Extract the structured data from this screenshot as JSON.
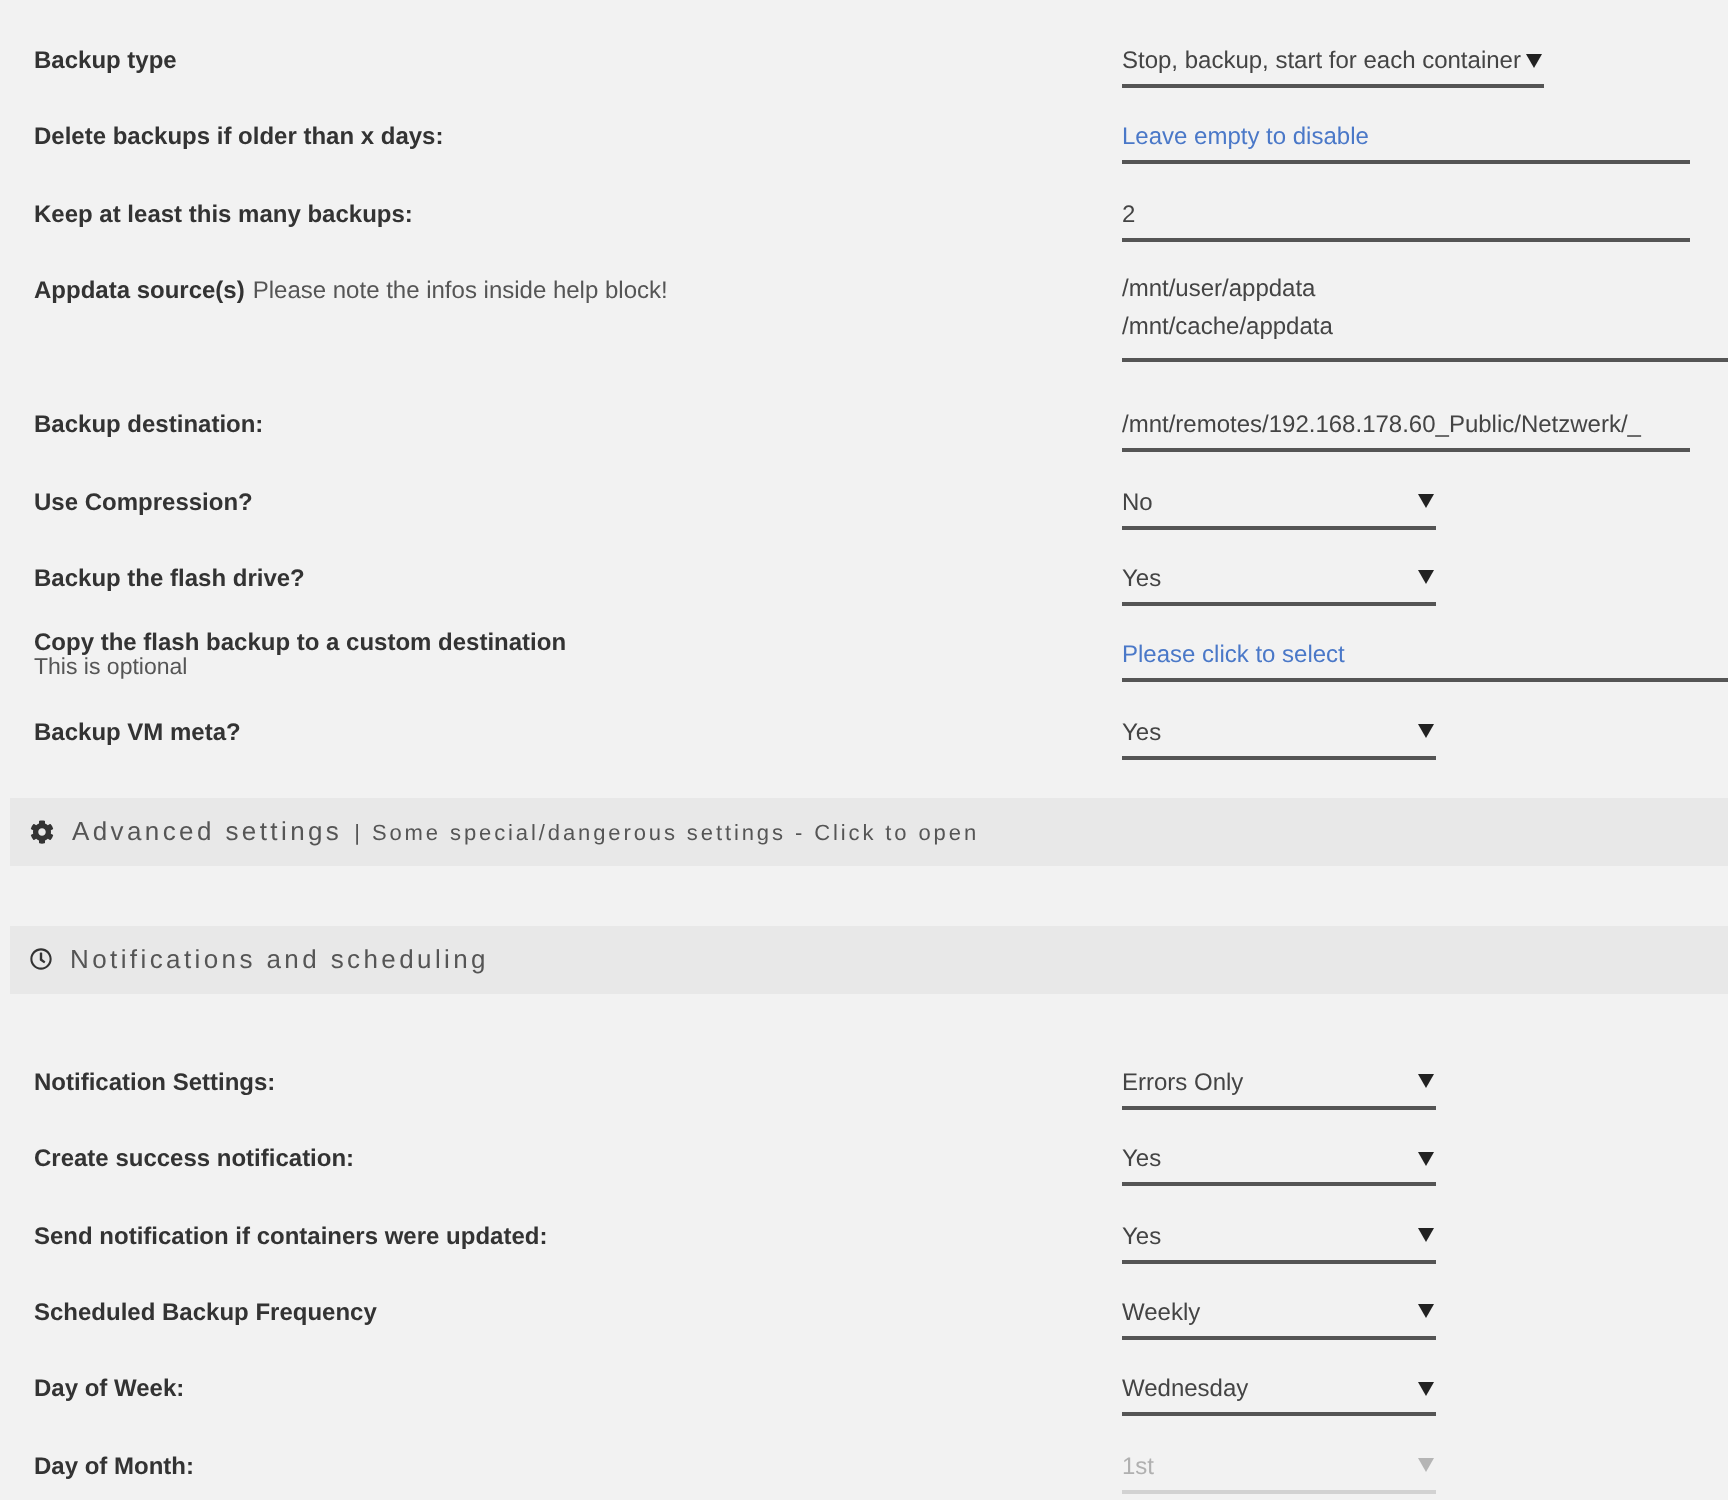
{
  "rows": [
    {
      "label": "Backup type",
      "kind": "select",
      "value": "Stop, backup, start for each container",
      "disabled": false
    },
    {
      "label": "Delete backups if older than x days:",
      "kind": "input",
      "placeholder": "Leave empty to disable",
      "disabled": false
    },
    {
      "label": "Keep at least this many backups:",
      "kind": "input",
      "value": "2",
      "disabled": false
    },
    {
      "label": "Appdata source(s)",
      "note": "Please note the infos inside help block!",
      "kind": "textarea",
      "value": "/mnt/user/appdata\n/mnt/cache/appdata",
      "disabled": false
    },
    {
      "label": "Backup destination:",
      "kind": "input",
      "value": "/mnt/remotes/192.168.178.60_Public/Netzwerk/_",
      "disabled": false
    },
    {
      "label": "Use Compression?",
      "kind": "select",
      "value": "No",
      "disabled": false
    },
    {
      "label": "Backup the flash drive?",
      "kind": "select",
      "value": "Yes",
      "disabled": false
    },
    {
      "label": "Copy the flash backup to a custom destination",
      "hint": "This is optional",
      "kind": "picker",
      "placeholder": "Please click to select",
      "disabled": false
    },
    {
      "label": "Backup VM meta?",
      "kind": "select",
      "value": "Yes",
      "disabled": false
    }
  ],
  "sections": [
    {
      "kind": "advanced",
      "title": "Advanced settings",
      "subtitle": "| Some special/dangerous settings - Click to open"
    },
    {
      "kind": "schedule",
      "title": "Notifications and scheduling",
      "rows": [
        {
          "label": "Notification Settings:",
          "kind": "select",
          "value": "Errors Only",
          "disabled": false
        },
        {
          "label": "Create success notification:",
          "kind": "select",
          "value": "Yes",
          "disabled": false
        },
        {
          "label": "Send notification if containers were updated:",
          "kind": "select",
          "value": "Yes",
          "disabled": false
        },
        {
          "label": "Scheduled Backup Frequency",
          "kind": "select",
          "value": "Weekly",
          "disabled": false
        },
        {
          "label": "Day of Week:",
          "kind": "select",
          "value": "Wednesday",
          "disabled": false
        },
        {
          "label": "Day of Month:",
          "kind": "select",
          "value": "1st",
          "disabled": true
        }
      ]
    }
  ]
}
